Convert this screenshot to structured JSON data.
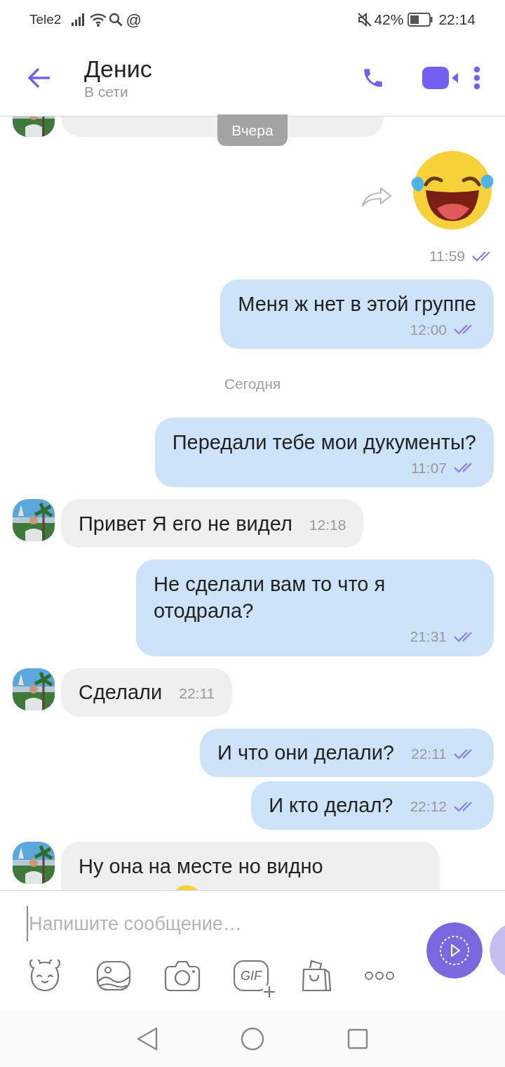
{
  "status_bar": {
    "carrier": "Tele2",
    "notification_glyph": "@",
    "battery": "42%",
    "time": "22:14"
  },
  "header": {
    "name": "Денис",
    "status": "В сети"
  },
  "floating_date": "Вчера",
  "messages": [
    {
      "kind": "in_cut"
    },
    {
      "kind": "sticker",
      "time": "11:59",
      "read": true
    },
    {
      "kind": "out_block",
      "text": "Меня ж нет в этой группе",
      "time": "12:00",
      "read": true
    },
    {
      "kind": "date",
      "text": "Сегодня"
    },
    {
      "kind": "out_block",
      "text": "Передали тебе мои дукументы?",
      "time": "11:07",
      "read": true
    },
    {
      "kind": "in_inline",
      "text": "Привет Я его не видел",
      "time": "12:18"
    },
    {
      "kind": "out_block",
      "text": "Не сделали вам то что я отодрала?",
      "time": "21:31",
      "read": true
    },
    {
      "kind": "in_inline",
      "text": "Сделали",
      "time": "22:11"
    },
    {
      "kind": "out_inline",
      "text": "И что они делали?",
      "time": "22:11",
      "read": true
    },
    {
      "kind": "out_inline",
      "text": "И кто делал?",
      "time": "22:12",
      "read": true
    },
    {
      "kind": "in_block",
      "text": "Ну она на месте но видно"
    }
  ],
  "composer": {
    "placeholder": "Напишите сообщение…",
    "gif_label": "GIF"
  }
}
